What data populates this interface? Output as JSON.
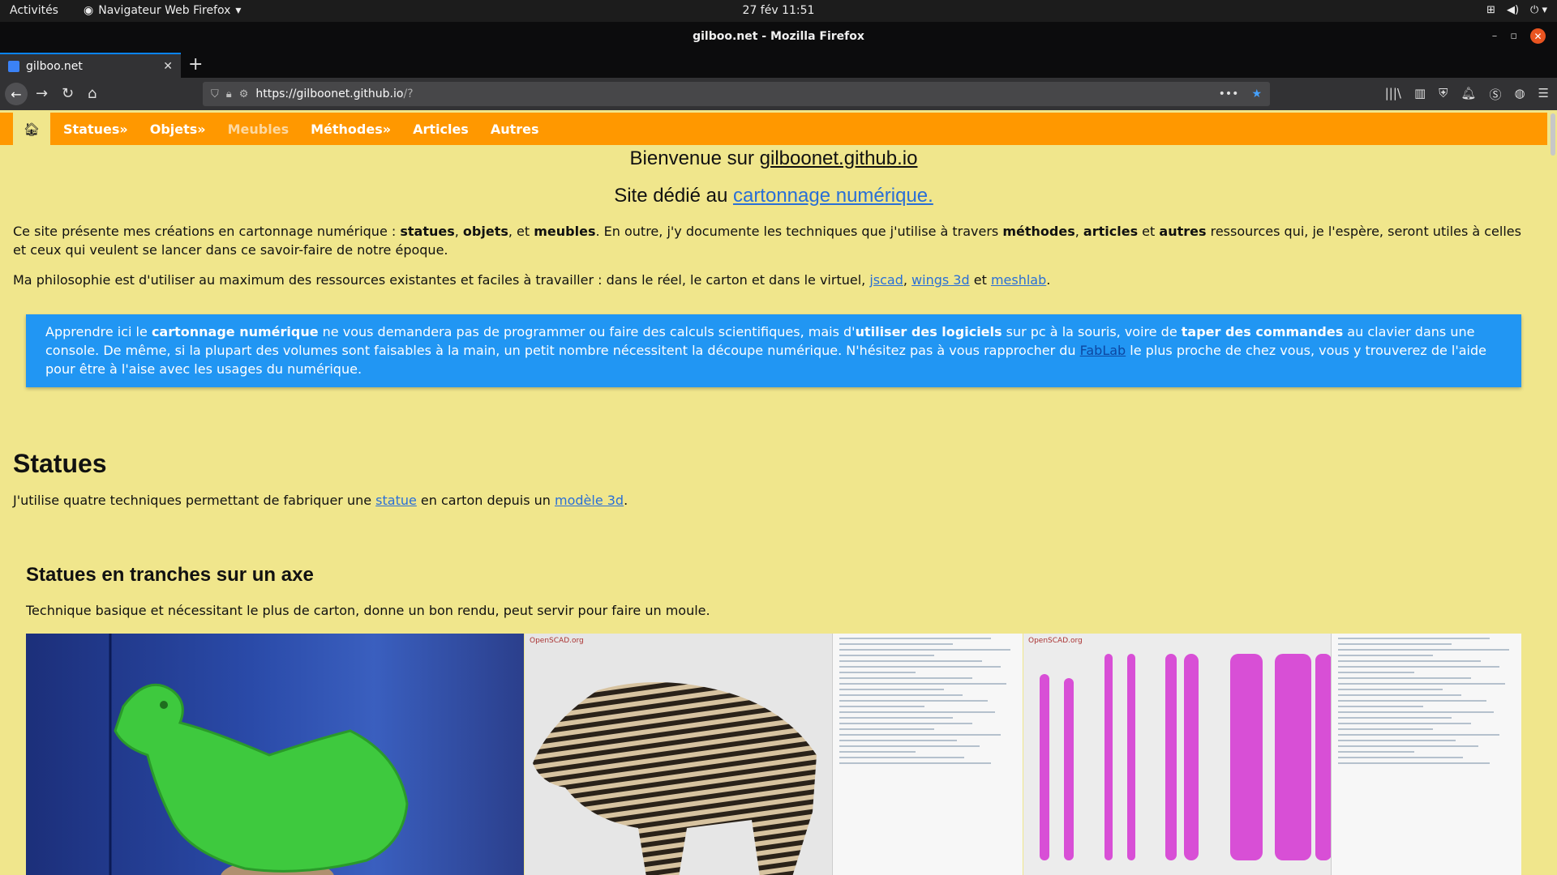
{
  "system": {
    "activities": "Activités",
    "app_menu": "Navigateur Web Firefox",
    "clock": "27 fév  11:51"
  },
  "window": {
    "title": "gilboo.net - Mozilla Firefox"
  },
  "tab": {
    "title": "gilboo.net"
  },
  "urlbar": {
    "url_main": "https://gilboonet.github.io",
    "url_rest": "/?"
  },
  "sitenav": {
    "items": [
      {
        "label": "Statues»"
      },
      {
        "label": "Objets»"
      },
      {
        "label": "Meubles"
      },
      {
        "label": "Méthodes»"
      },
      {
        "label": "Articles"
      },
      {
        "label": "Autres"
      }
    ]
  },
  "page": {
    "welcome_prefix": "Bienvenue sur ",
    "welcome_link": "gilboonet.github.io",
    "subtitle_prefix": "Site dédié au ",
    "subtitle_link": "cartonnage numérique.",
    "intro": {
      "t1": "Ce site présente mes créations en cartonnage numérique : ",
      "b1": "statues",
      "t2": ", ",
      "b2": "objets",
      "t3": ", et ",
      "b3": "meubles",
      "t4": ". En outre, j'y documente les techniques que j'utilise à travers ",
      "b4": "méthodes",
      "t5": ", ",
      "b5": "articles",
      "t6": " et ",
      "b6": "autres",
      "t7": " ressources qui, je l'espère, seront utiles à celles et ceux qui veulent se lancer dans ce savoir-faire de notre époque."
    },
    "philosophy": {
      "t1": "Ma philosophie est d'utiliser au maximum des ressources existantes et faciles à travailler : dans le réel, le carton et dans le virtuel, ",
      "l1": "jscad",
      "t2": ", ",
      "l2": "wings 3d",
      "t3": " et ",
      "l3": "meshlab",
      "t4": "."
    },
    "info": {
      "t1": "Apprendre ici le ",
      "b1": "cartonnage numérique",
      "t2": " ne vous demandera pas de programmer ou faire des calculs scientifiques, mais d'",
      "b2": "utiliser des logiciels",
      "t3": " sur pc à la souris, voire de ",
      "b3": "taper des commandes",
      "t4": " au clavier dans une console. De même, si la plupart des volumes sont faisables à la main, un petit nombre nécessitent la découpe numérique. N'hésitez pas à vous rapprocher du ",
      "l1": "FabLab",
      "t5": " le plus proche de chez vous, vous y trouverez de l'aide pour être à l'aise avec les usages du numérique."
    },
    "statues_heading": "Statues",
    "statues_intro": {
      "t1": "J'utilise quatre techniques permettant de fabriquer une ",
      "l1": "statue",
      "t2": " en carton depuis un ",
      "l2": "modèle 3d",
      "t3": "."
    },
    "section_heading": "Statues en tranches sur un axe",
    "section_text": "Technique basique et nécessitant le plus de carton, donne un bon rendu, peut servir pour faire un moule.",
    "scad_label": "OpenSCAD.org"
  },
  "colors": {
    "page_bg": "#f0e68c",
    "nav_bg": "#ff9800",
    "info_bg": "#2196f3",
    "link": "#2a6fd6"
  }
}
